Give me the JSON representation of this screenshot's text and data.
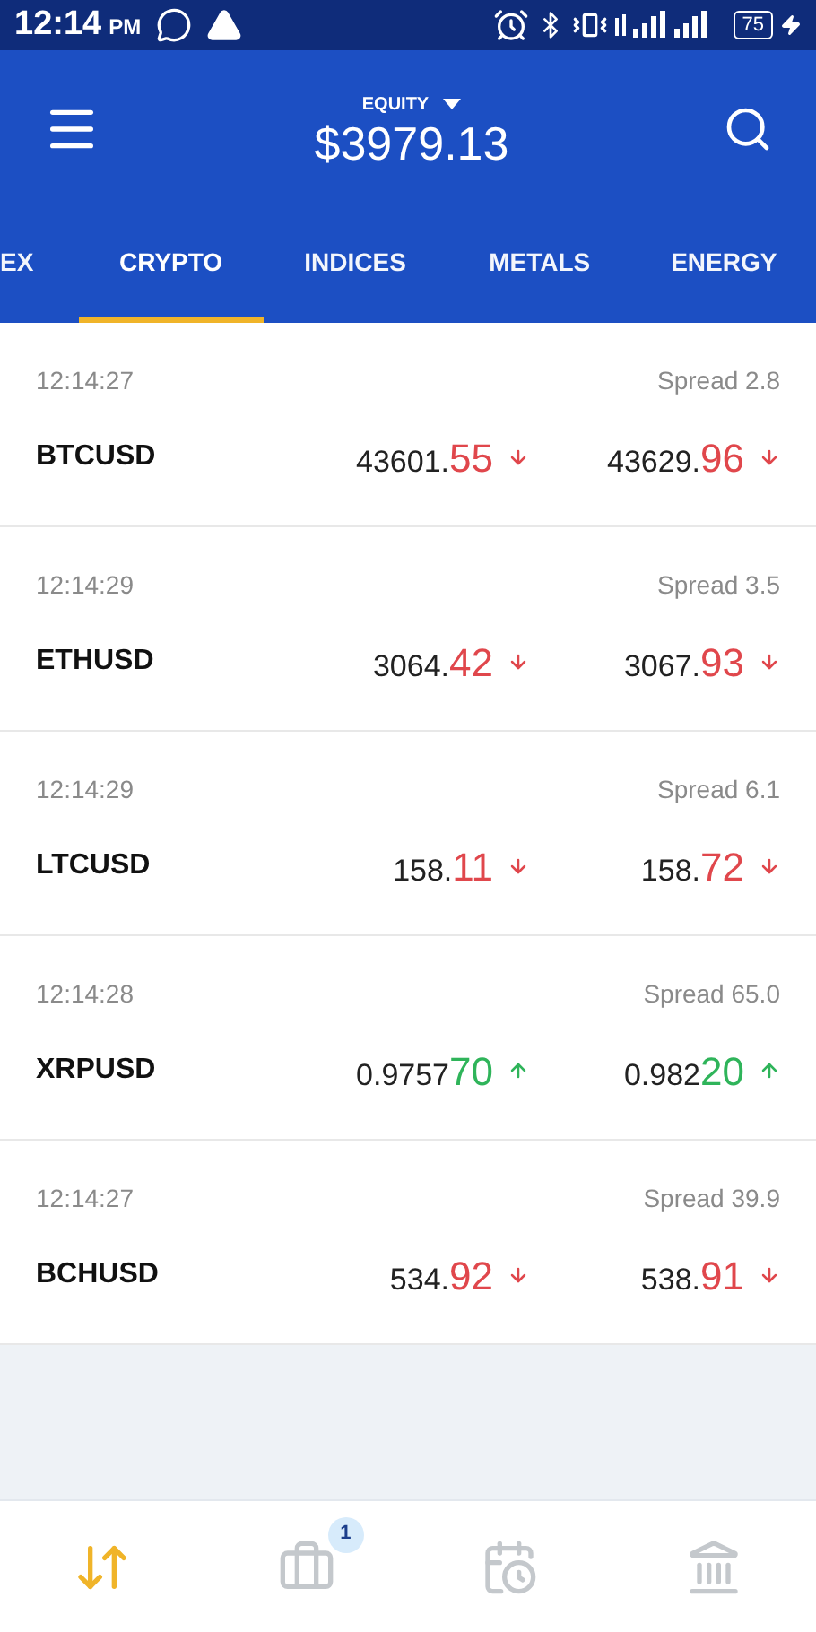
{
  "status_bar": {
    "time": "12:14",
    "period": "PM",
    "battery": "75"
  },
  "header": {
    "label": "EQUITY",
    "value": "$3979.13"
  },
  "tabs": [
    {
      "label": "EX",
      "selected": false
    },
    {
      "label": "CRYPTO",
      "selected": true
    },
    {
      "label": "INDICES",
      "selected": false
    },
    {
      "label": "METALS",
      "selected": false
    },
    {
      "label": "ENERGY",
      "selected": false
    }
  ],
  "quotes": [
    {
      "time": "12:14:27",
      "spread": "Spread 2.8",
      "symbol": "BTCUSD",
      "bid": {
        "base": "43601.",
        "tail": "55",
        "kind": "down"
      },
      "ask": {
        "base": "43629.",
        "tail": "96",
        "kind": "down"
      }
    },
    {
      "time": "12:14:29",
      "spread": "Spread 3.5",
      "symbol": "ETHUSD",
      "bid": {
        "base": "3064.",
        "tail": "42",
        "kind": "down"
      },
      "ask": {
        "base": "3067.",
        "tail": "93",
        "kind": "down"
      }
    },
    {
      "time": "12:14:29",
      "spread": "Spread 6.1",
      "symbol": "LTCUSD",
      "bid": {
        "base": "158.",
        "tail": "11",
        "kind": "down"
      },
      "ask": {
        "base": "158.",
        "tail": "72",
        "kind": "down"
      }
    },
    {
      "time": "12:14:28",
      "spread": "Spread 65.0",
      "symbol": "XRPUSD",
      "bid": {
        "base": "0.9757",
        "tail": "70",
        "kind": "up"
      },
      "ask": {
        "base": "0.982",
        "tail": "20",
        "kind": "up"
      }
    },
    {
      "time": "12:14:27",
      "spread": "Spread 39.9",
      "symbol": "BCHUSD",
      "bid": {
        "base": "534.",
        "tail": "92",
        "kind": "down"
      },
      "ask": {
        "base": "538.",
        "tail": "91",
        "kind": "down"
      }
    }
  ],
  "bottom_nav": [
    {
      "kind": "trade",
      "selected": true
    },
    {
      "kind": "portfolio",
      "selected": false,
      "badge": "1"
    },
    {
      "kind": "history",
      "selected": false
    },
    {
      "kind": "bank",
      "selected": false
    }
  ]
}
